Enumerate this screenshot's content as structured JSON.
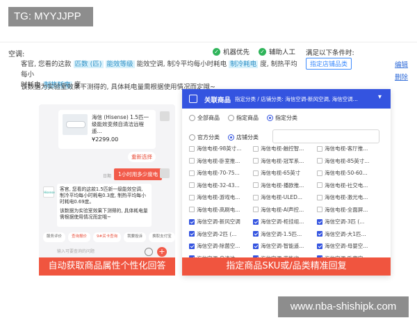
{
  "tag_label": "TG: MYYJJPP",
  "watermark": "www.nba-shishipk.com",
  "rule": {
    "label": "空调:",
    "robot_first": "机器优先",
    "human_assist": "辅助人工",
    "condition_label": "满足以下条件时:",
    "condition_tag": "指定店铺品类",
    "edit": "编辑",
    "delete": "删除",
    "text_before": "客官, 您看的这款",
    "chip_match": "匹数 (匹)",
    "chip_level": "能效等级",
    "text_mid": "能效空调, 制冷平均每小时耗电",
    "chip_cool": "制冷耗电",
    "text_mid2": "度, 制热平均每小",
    "line2_prefix": "时耗电",
    "chip_heat": "制热耗电",
    "line2_suffix": "度。",
    "note": "该数据为实验室效果下测得的, 具体耗电量需根据使用情况而定哦~"
  },
  "chat": {
    "product_title": "海信 (Hisense) 1.5匹一级能效变频自清洁远程遥...",
    "product_price": "¥2299.00",
    "reselect": "重新选择",
    "time": "日期",
    "user_msg": "1小时用多少度电",
    "bot_logo": "Hisense",
    "bot_msg_1": "客官, 您看的这款1.5匹新一级能效空调, 制冷平均每小时耗电0.3度, 制热平均每小时耗电0.69度。",
    "bot_msg_2": "该数据为实验室效果下测得的, 具体耗电量需根据使用情况而定哦~",
    "quick": [
      "服务评价",
      "查询报价",
      "9#买卡查询",
      "我要投诉",
      "换取支付宝",
      "发"
    ],
    "input_placeholder": "输入可要查询的问题",
    "caption": "自动获取商品属性个性化回答"
  },
  "config": {
    "title": "关联商品",
    "subtitle": "指定分类 / 店铺分类: 海信空调-新风空调, 海信空调...",
    "scope_options": [
      "全部商品",
      "指定商品",
      "指定分类"
    ],
    "scope_selected": 2,
    "cat_options": [
      "官方分类",
      "店铺分类"
    ],
    "cat_selected": 1,
    "items": [
      {
        "label": "海信电视-98英寸...",
        "checked": false
      },
      {
        "label": "海信电视-触控智...",
        "checked": false
      },
      {
        "label": "海信电视-客厅推...",
        "checked": false
      },
      {
        "label": "海信电视-卧室推...",
        "checked": false
      },
      {
        "label": "海信电视-冠军系...",
        "checked": false
      },
      {
        "label": "海信电视-85英寸...",
        "checked": false
      },
      {
        "label": "海信电视-70-75...",
        "checked": false
      },
      {
        "label": "海信电视-65英寸",
        "checked": false
      },
      {
        "label": "海信电视-50-60...",
        "checked": false
      },
      {
        "label": "海信电视-32-43...",
        "checked": false
      },
      {
        "label": "海信电视-播欧推...",
        "checked": false
      },
      {
        "label": "海信电视-社交电...",
        "checked": false
      },
      {
        "label": "海信电视-游戏电...",
        "checked": false
      },
      {
        "label": "海信电视-ULED...",
        "checked": false
      },
      {
        "label": "海信电视-激光电...",
        "checked": false
      },
      {
        "label": "海信电视-高刷电...",
        "checked": false
      },
      {
        "label": "海信电视-AI声控...",
        "checked": false
      },
      {
        "label": "海信电视-全面屏...",
        "checked": false
      },
      {
        "label": "海信空调-新风空调",
        "checked": true
      },
      {
        "label": "海信空调-柜挂组...",
        "checked": true
      },
      {
        "label": "海信空调-3匹 (...",
        "checked": true
      },
      {
        "label": "海信空调-2匹 (...",
        "checked": true
      },
      {
        "label": "海信空调-1.5匹...",
        "checked": true
      },
      {
        "label": "海信空调-大1匹...",
        "checked": true
      },
      {
        "label": "海信空调-除菌空...",
        "checked": true
      },
      {
        "label": "海信空调-智能遥...",
        "checked": true
      },
      {
        "label": "海信空调-母婴空...",
        "checked": true
      },
      {
        "label": "海信空调-自清洁...",
        "checked": true
      },
      {
        "label": "海信空调-节能省...",
        "checked": true
      },
      {
        "label": "海信空调-卧室空...",
        "checked": true
      }
    ],
    "caption": "指定商品SKU或/品类精准回复"
  },
  "colors": {
    "accent_blue": "#3454e0",
    "accent_red": "#f0553f",
    "success_green": "#2fb45a"
  }
}
